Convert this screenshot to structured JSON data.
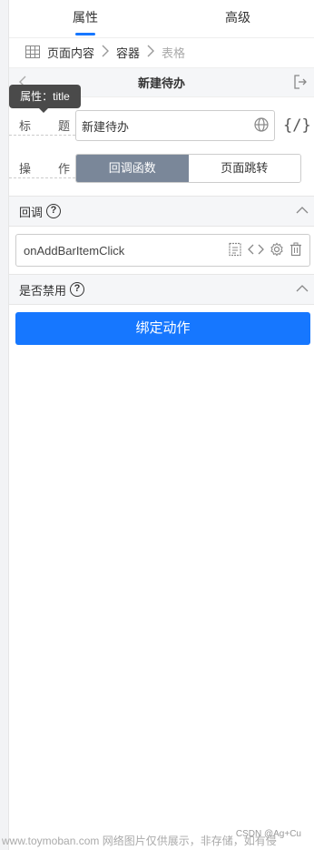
{
  "tabs": [
    {
      "label": "属性",
      "active": true
    },
    {
      "label": "高级",
      "active": false
    }
  ],
  "breadcrumb": {
    "items": [
      "页面内容",
      "容器",
      "表格"
    ]
  },
  "header": {
    "title": "新建待办"
  },
  "tooltip": {
    "text": "属性：title"
  },
  "form": {
    "title_label_a": "标",
    "title_label_b": "题",
    "title_value": "新建待办",
    "var_icon": "{/}",
    "op_label_a": "操",
    "op_label_b": "作",
    "op_options": [
      "回调函数",
      "页面跳转"
    ],
    "op_selected": "回调函数"
  },
  "sections": {
    "callback": "回调",
    "disabled": "是否禁用"
  },
  "callback": {
    "function_name": "onAddBarItemClick"
  },
  "actions": {
    "bind_label": "绑定动作"
  },
  "footer": {
    "watermark": "www.toymoban.com 网络图片仅供展示，非存储，如有侵",
    "credit": "CSDN @Ag+Cu"
  },
  "colors": {
    "accent": "#1677ff",
    "segment_active": "#7a8799",
    "tooltip_bg": "#4a4a4a"
  }
}
